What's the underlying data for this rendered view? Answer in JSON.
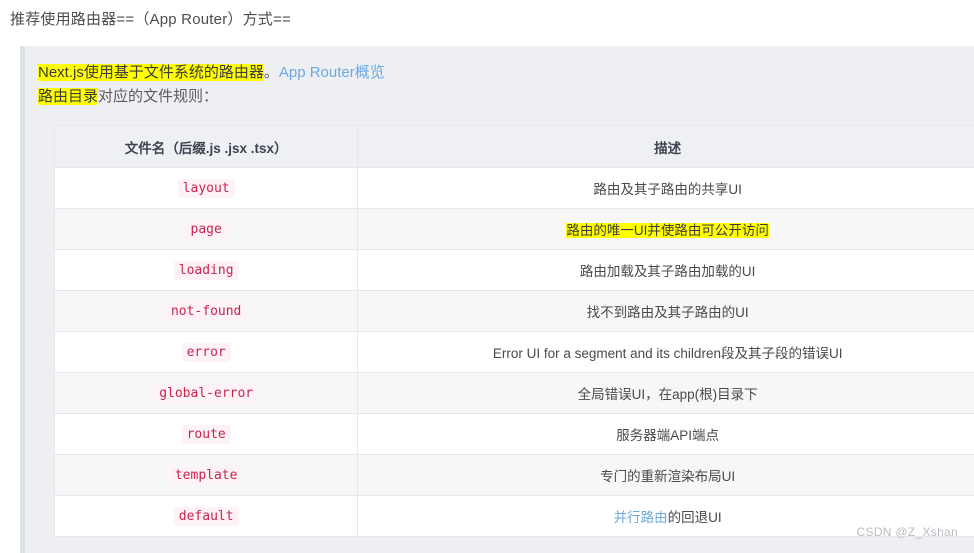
{
  "document": {
    "heading": "推荐使用路由器==（App Router）方式=="
  },
  "note": {
    "line1_highlight": "Next.js使用基于文件系统的路由器",
    "line1_punct": "。",
    "line1_link": "App Router概览",
    "line2_highlight": "路由目录",
    "line2_rest": "对应的文件规则："
  },
  "table": {
    "headers": {
      "filename": "文件名（后缀.js .jsx .tsx）",
      "description": "描述"
    },
    "rows": [
      {
        "file": "layout",
        "desc": "路由及其子路由的共享UI",
        "highlight": false,
        "link": false
      },
      {
        "file": "page",
        "desc": "路由的唯一UI并使路由可公开访问",
        "highlight": true,
        "link": false
      },
      {
        "file": "loading",
        "desc": "路由加载及其子路由加载的UI",
        "highlight": false,
        "link": false
      },
      {
        "file": "not-found",
        "desc": "找不到路由及其子路由的UI",
        "highlight": false,
        "link": false
      },
      {
        "file": "error",
        "desc": "Error UI for a segment and its children段及其子段的错误UI",
        "highlight": false,
        "link": false
      },
      {
        "file": "global-error",
        "desc": "全局错误UI，在app(根)目录下",
        "highlight": false,
        "link": false
      },
      {
        "file": "route",
        "desc": "服务器端API端点",
        "highlight": false,
        "link": false
      },
      {
        "file": "template",
        "desc": "专门的重新渲染布局UI",
        "highlight": false,
        "link": false
      },
      {
        "file": "default",
        "desc": "的回退UI",
        "link_text": "并行路由",
        "highlight": false,
        "link": true
      }
    ]
  },
  "watermark": {
    "text": "CSDN @Z_Xshan"
  },
  "colors": {
    "highlight": "#ffff00",
    "link": "#6ea8e0",
    "code_text": "#c7254e",
    "code_bg": "#fdf2f5",
    "panel_bg": "#edeff2",
    "panel_border": "#dfe2e8",
    "header_bg": "#eef0f3",
    "row_alt_bg": "#f7f7f8"
  }
}
